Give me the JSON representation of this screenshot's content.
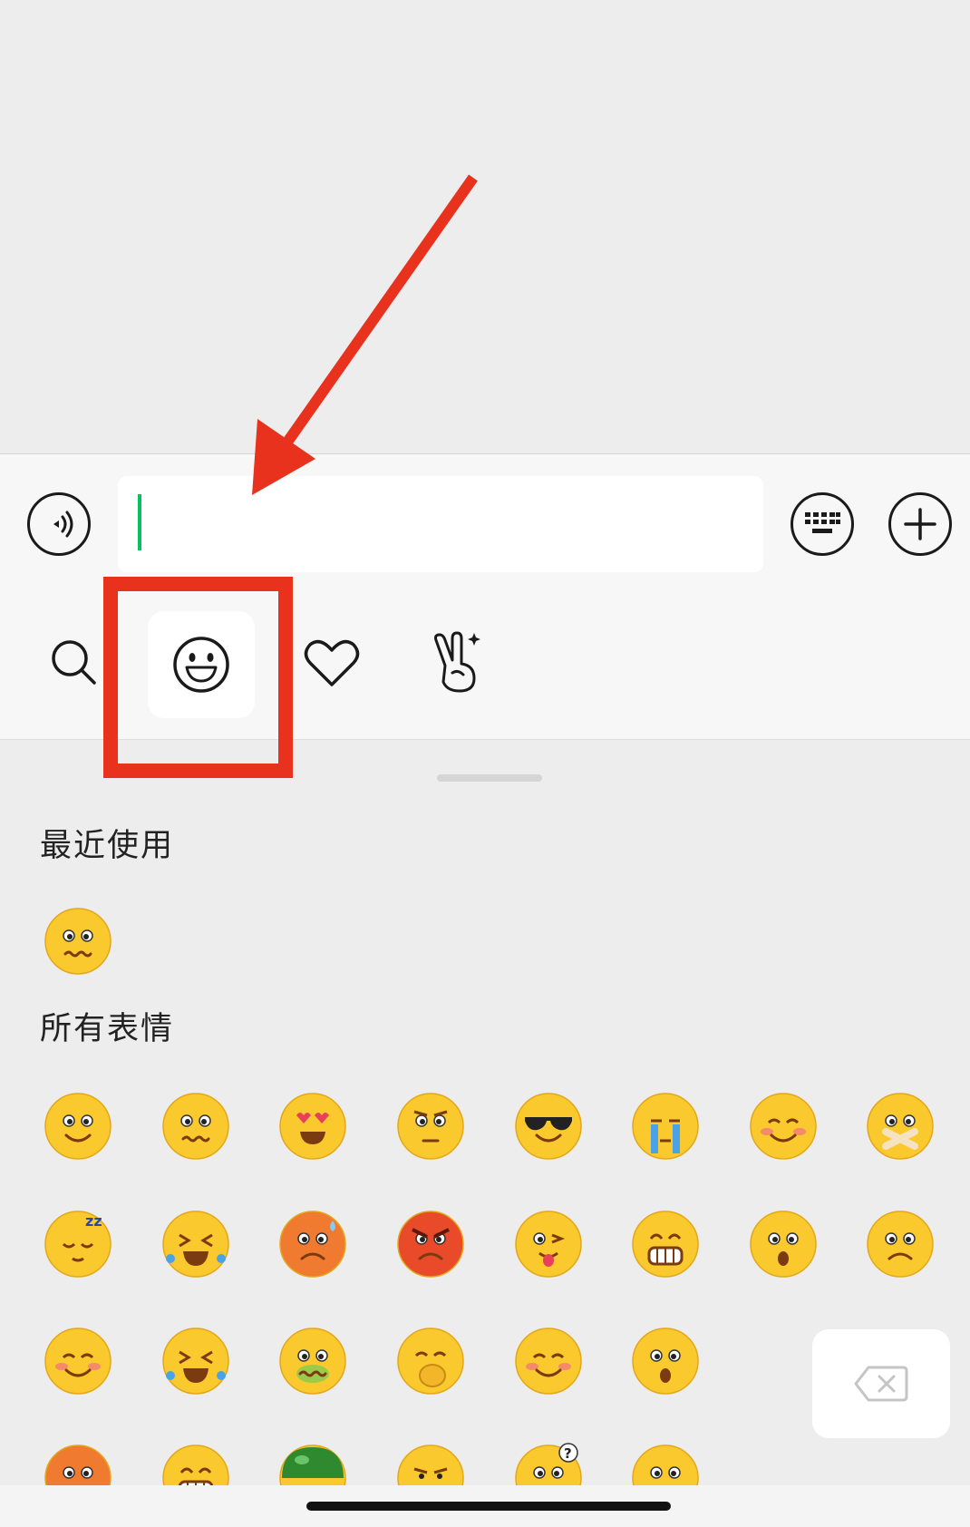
{
  "input": {
    "value": "",
    "placeholder": ""
  },
  "toolbar": {
    "voice_icon": "voice-icon",
    "keyboard_icon": "keyboard-icon",
    "plus_icon": "plus-icon"
  },
  "tabs": [
    {
      "icon": "search-icon",
      "selected": false
    },
    {
      "icon": "emoji-face-icon",
      "selected": true
    },
    {
      "icon": "heart-icon",
      "selected": false
    },
    {
      "icon": "victory-hand-icon",
      "selected": false
    }
  ],
  "sections": {
    "recent_title": "最近使用",
    "all_title": "所有表情"
  },
  "emoji_panel": {
    "recent": [
      "worried-emoji"
    ],
    "all": [
      "smile-emoji",
      "worried-emoji",
      "heart-eyes-emoji",
      "glare-emoji",
      "sunglasses-emoji",
      "crying-emoji",
      "shy-emoji",
      "shut-mouth-emoji",
      "sleepy-emoji",
      "laugh-cry-emoji",
      "sweat-emoji",
      "angry-emoji",
      "tongue-wink-emoji",
      "grin-emoji",
      "surprised-emoji",
      "sad-emoji",
      "blush-emoji",
      "big-laugh-emoji",
      "sick-emoji",
      "face-palm-emoji",
      "happy-blush-emoji",
      "shocked-emoji",
      "frustrated-emoji",
      "grin-squint-emoji",
      "helmet-emoji",
      "smirk-emoji",
      "question-emoji",
      "astonished-emoji"
    ]
  },
  "delete_icon": "backspace-icon",
  "colors": {
    "accent_green": "#07c160",
    "annotation_red": "#e8321d",
    "emoji_yellow": "#f9c92e"
  }
}
